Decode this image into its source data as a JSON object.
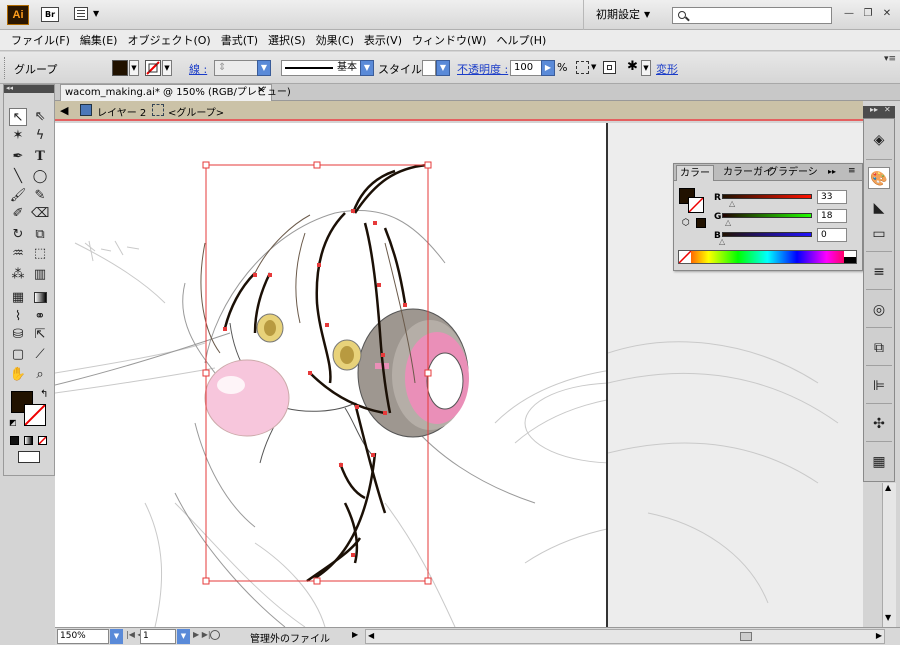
{
  "app": {
    "logo": "Ai",
    "bridge_logo": "Br",
    "workspace": "初期設定",
    "search_placeholder": ""
  },
  "menu": [
    "ファイル(F)",
    "編集(E)",
    "オブジェクト(O)",
    "書式(T)",
    "選択(S)",
    "効果(C)",
    "表示(V)",
    "ウィンドウ(W)",
    "ヘルプ(H)"
  ],
  "controlbar": {
    "selection": "グループ",
    "stroke_label": "線 :",
    "brush": "基本",
    "style_label": "スタイル :",
    "opacity_label": "不透明度 :",
    "opacity_value": "100",
    "percent": "%",
    "transform": "変形"
  },
  "document": {
    "tab": "wacom_making.ai* @ 150% (RGB/プレビュー)",
    "layer": "レイヤー 2",
    "group": "<グループ>"
  },
  "color_panel": {
    "tabs": [
      "カラー",
      "カラーガイ",
      "グラデーシ"
    ],
    "r_label": "R",
    "r_value": "33",
    "g_label": "G",
    "g_value": "18",
    "b_label": "B",
    "b_value": "0",
    "fill_color": "#211200"
  },
  "status": {
    "zoom": "150%",
    "page": "1",
    "info": "管理外のファイル"
  },
  "colors": {
    "selection": "#e63a3a",
    "artboard_border": "#333333",
    "crumb_bg": "#cbc2a7",
    "gum": "#f7c6dc",
    "headphone_gray": "#9e9790",
    "headphone_pink": "#ea8fb8"
  },
  "icons": {
    "tools": [
      "selection-icon",
      "direct-selection-icon",
      "magic-wand-icon",
      "lasso-icon",
      "pen-icon",
      "type-icon",
      "line-icon",
      "ellipse-icon",
      "paintbrush-icon",
      "pencil-icon",
      "blob-brush-icon",
      "eraser-icon",
      "rotate-icon",
      "scale-icon",
      "warp-icon",
      "free-transform-icon",
      "symbol-sprayer-icon",
      "graph-icon",
      "mesh-icon",
      "gradient-icon",
      "eyedropper-icon",
      "blend-icon",
      "live-paint-icon",
      "live-paint-select-icon",
      "artboard-icon",
      "slice-icon",
      "hand-icon",
      "zoom-icon"
    ],
    "dock": [
      "layers-icon",
      "color-icon",
      "gradient-panel-icon",
      "transparency-icon",
      "stroke-icon",
      "appearance-icon",
      "pathfinder-icon",
      "align-icon",
      "symbols-icon",
      "swatches-icon"
    ]
  }
}
